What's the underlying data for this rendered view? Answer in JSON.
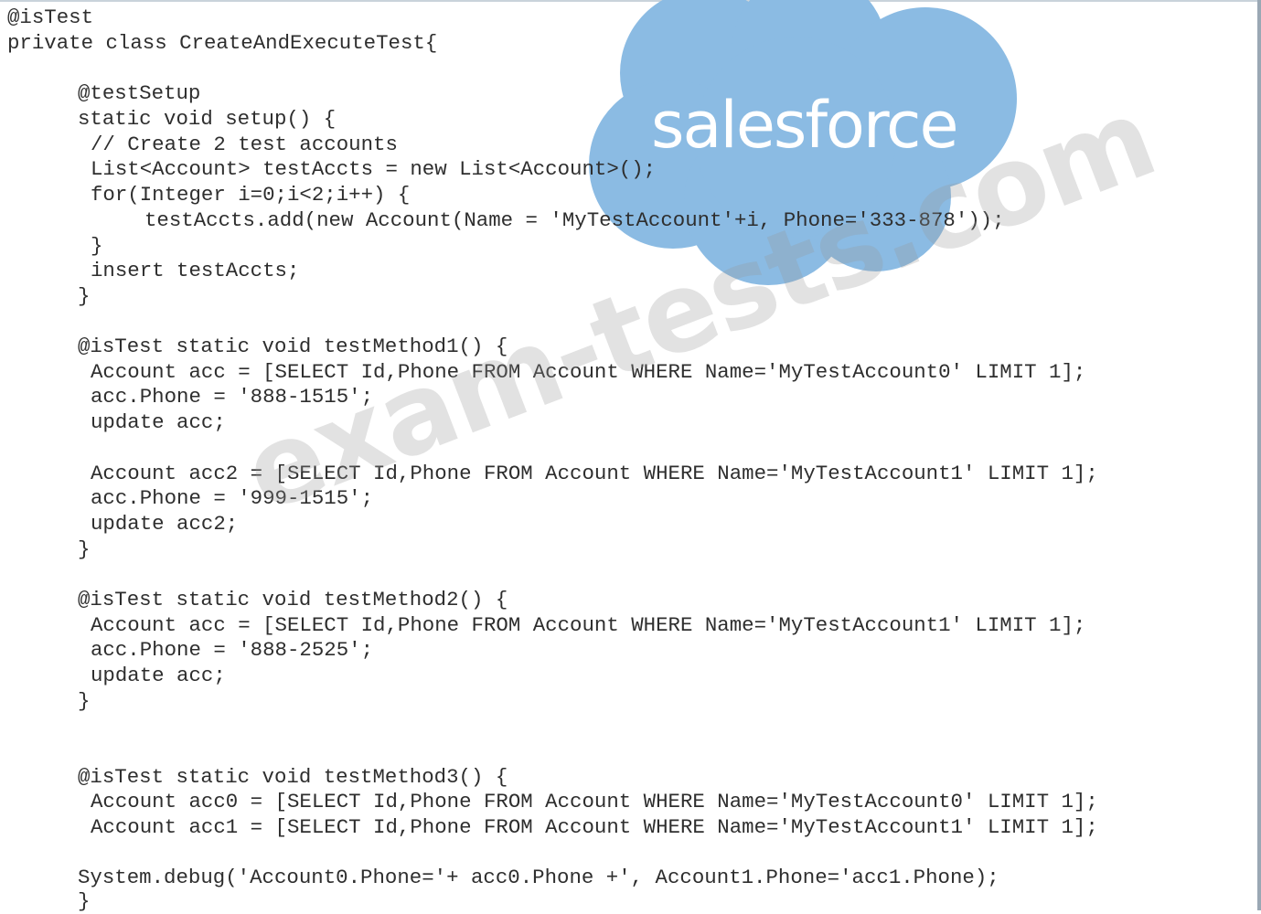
{
  "logo": {
    "text": "salesforce",
    "cloud_color": "#8bbbe3",
    "icon": "salesforce-cloud-icon"
  },
  "watermark": {
    "text": "exam-tests.com"
  },
  "code_lines": [
    "@isTest",
    "private class CreateAndExecuteTest{",
    "@testSetup",
    "static void setup() {",
    "// Create 2 test accounts",
    "List<Account> testAccts = new List<Account>();",
    "for(Integer i=0;i<2;i++) {",
    "testAccts.add(new Account(Name = 'MyTestAccount'+i, Phone='333-878'));",
    "}",
    "insert testAccts;",
    "}",
    "@isTest static void testMethod1() {",
    "Account acc = [SELECT Id,Phone FROM Account WHERE Name='MyTestAccount0' LIMIT 1];",
    "acc.Phone = '888-1515';",
    "update acc;",
    "Account acc2 = [SELECT Id,Phone FROM Account WHERE Name='MyTestAccount1' LIMIT 1];",
    "acc.Phone = '999-1515';",
    "update acc2;",
    "}",
    "@isTest static void testMethod2() {",
    "Account acc = [SELECT Id,Phone FROM Account WHERE Name='MyTestAccount1' LIMIT 1];",
    "acc.Phone = '888-2525';",
    "update acc;",
    "}",
    "@isTest static void testMethod3() {",
    "Account acc0 = [SELECT Id,Phone FROM Account WHERE Name='MyTestAccount0' LIMIT 1];",
    "Account acc1 = [SELECT Id,Phone FROM Account WHERE Name='MyTestAccount1' LIMIT 1];",
    "System.debug('Account0.Phone='+ acc0.Phone +', Account1.Phone='acc1.Phone);",
    "}"
  ]
}
